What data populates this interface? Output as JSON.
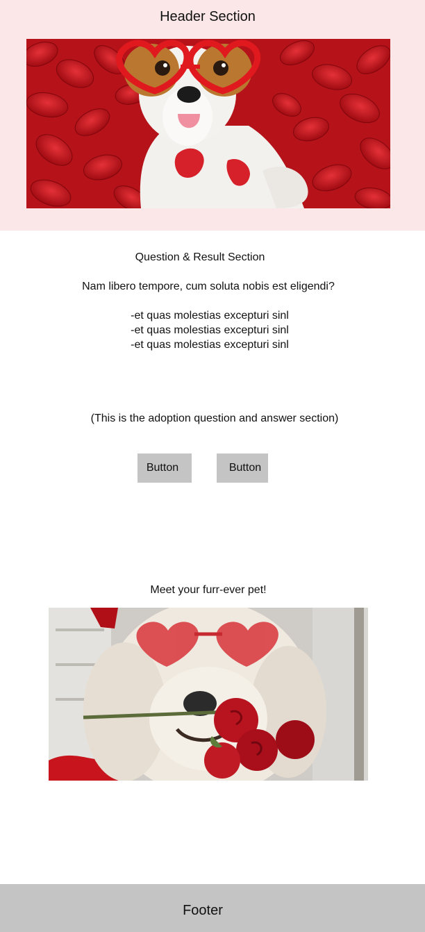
{
  "header": {
    "title": "Header Section"
  },
  "question_section": {
    "title": "Question & Result Section",
    "question": "Nam libero tempore, cum soluta nobis est eligendi?",
    "answers": [
      "-et quas molestias excepturi sinl",
      "-et quas molestias excepturi sinl",
      "-et quas molestias excepturi sinl"
    ],
    "note": "(This is the adoption question and answer section)",
    "buttons": [
      {
        "label": "Button"
      },
      {
        "label": "Button"
      }
    ]
  },
  "result": {
    "title": "Meet your furr-ever pet!"
  },
  "footer": {
    "label": "Footer"
  },
  "colors": {
    "header_bg": "#fbe7e7",
    "button_bg": "#c4c4c4",
    "footer_bg": "#c4c4c4",
    "text": "#111111",
    "accent_red": "#c4161c"
  },
  "images": {
    "hero": "dog-with-heart-glasses-on-rose-petals-image",
    "pet": "fluffy-dog-with-heart-glasses-and-roses-image"
  }
}
